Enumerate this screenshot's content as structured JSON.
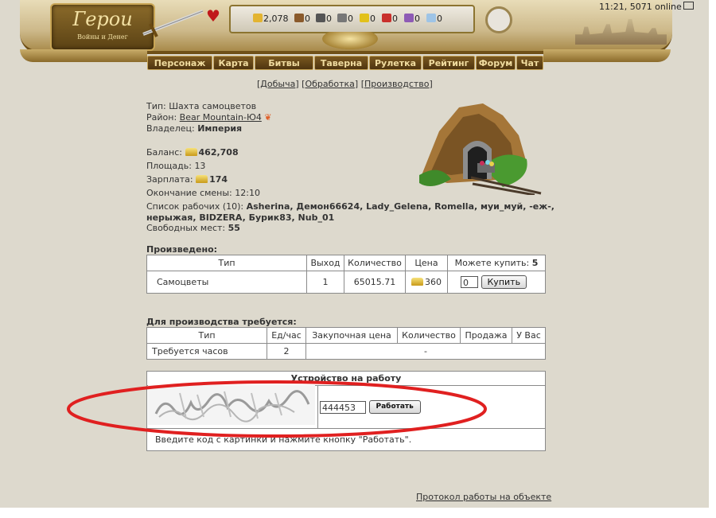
{
  "header": {
    "logo_title": "Герои",
    "logo_sub": "Войны и Денег",
    "time_online": "11:21, 5071 online",
    "resources": [
      {
        "icon": "gold-icon",
        "value": "2,078",
        "color": "#e3b431"
      },
      {
        "icon": "wood-icon",
        "value": "0",
        "color": "#8a5a2b"
      },
      {
        "icon": "ore-icon",
        "value": "0",
        "color": "#555555"
      },
      {
        "icon": "mercury-icon",
        "value": "0",
        "color": "#777777"
      },
      {
        "icon": "sulfur-icon",
        "value": "0",
        "color": "#e2c11a"
      },
      {
        "icon": "crystal-icon",
        "value": "0",
        "color": "#c9302c"
      },
      {
        "icon": "gems-icon",
        "value": "0",
        "color": "#8e5bb5"
      },
      {
        "icon": "diamond-icon",
        "value": "0",
        "color": "#9ec4e6"
      }
    ]
  },
  "menu": [
    "Персонаж",
    "Карта",
    "Битвы",
    "Таверна",
    "Рулетка",
    "Рейтинг",
    "Форум",
    "Чат"
  ],
  "subnav": [
    "Добыча",
    "Обработка",
    "Производство"
  ],
  "info": {
    "type_label": "Тип:",
    "type_value": "Шахта самоцветов",
    "district_label": "Район:",
    "district_value": "Bear Mountain-Ю4",
    "owner_label": "Владелец:",
    "owner_value": "Империя",
    "balance_label": "Баланс:",
    "balance_value": "462,708",
    "area_label": "Площадь:",
    "area_value": "13",
    "salary_label": "Зарплата:",
    "salary_value": "174",
    "shift_end_label": "Окончание смены:",
    "shift_end_value": "12:10",
    "workers_label": "Список рабочих (10):",
    "workers_line1": "Asherina, Демон66624, Lady_Gelena, Romella, муи_муй, -еж-,",
    "workers_line2": "нерыжая, BIDZERA, Бурик83, Nub_01",
    "free_label": "Свободных мест:",
    "free_value": "55"
  },
  "produced": {
    "title": "Произведено:",
    "headers": [
      "Тип",
      "Выход",
      "Количество",
      "Цена",
      "Можете купить:"
    ],
    "can_buy_value": "5",
    "row": {
      "type": "Самоцветы",
      "output": "1",
      "quantity": "65015.71",
      "price": "360",
      "input_value": "0",
      "buy_button": "Купить"
    }
  },
  "required": {
    "title": "Для производства требуется:",
    "headers": [
      "Тип",
      "Ед/час",
      "Закупочная цена",
      "Количество",
      "Продажа",
      "У Вас"
    ],
    "row": {
      "type": "Требуется часов",
      "per_hour": "2",
      "rest": "-"
    }
  },
  "job": {
    "title": "Устройство на работу",
    "code_value": "444453",
    "work_button": "Работать",
    "hint": "Введите код с картинки и нажмите кнопку \"Работать\"."
  },
  "footer_link": "Протокол работы на объекте"
}
